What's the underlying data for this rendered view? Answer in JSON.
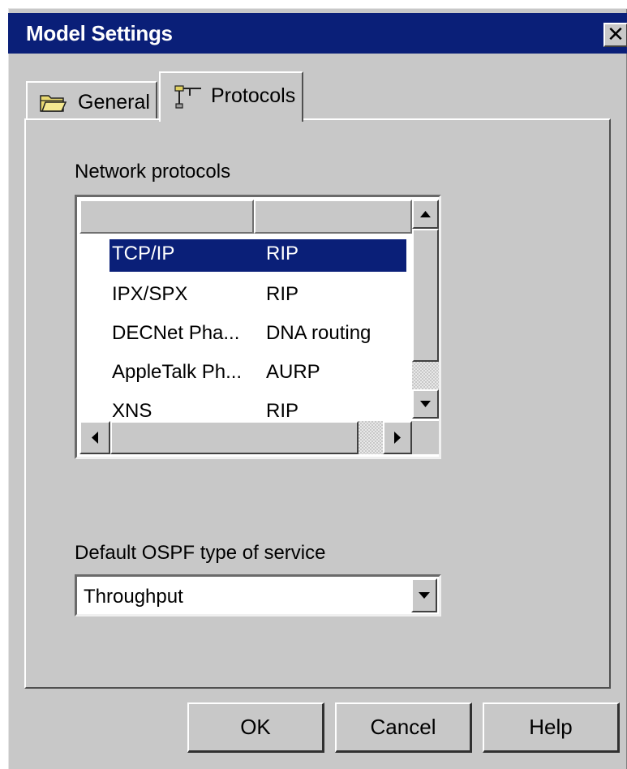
{
  "window": {
    "title": "Model Settings",
    "close_label": "✕"
  },
  "tabs": [
    {
      "label": "General",
      "icon": "folder-icon",
      "active": false
    },
    {
      "label": "Protocols",
      "icon": "network-connector-icon",
      "active": true
    }
  ],
  "network_protocols": {
    "label": "Network protocols",
    "columns": [
      "",
      ""
    ],
    "rows": [
      {
        "protocol": "TCP/IP",
        "routing": "RIP",
        "selected": true
      },
      {
        "protocol": "IPX/SPX",
        "routing": "RIP",
        "selected": false
      },
      {
        "protocol": "DECNet Pha...",
        "routing": "DNA routing",
        "selected": false
      },
      {
        "protocol": "AppleTalk Ph...",
        "routing": "AURP",
        "selected": false
      },
      {
        "protocol": "XNS",
        "routing": "RIP",
        "selected": false
      }
    ]
  },
  "ospf": {
    "label": "Default OSPF type of service",
    "value": "Throughput"
  },
  "buttons": {
    "ok": "OK",
    "cancel": "Cancel",
    "help": "Help"
  },
  "colors": {
    "titlebar": "#0a1f78",
    "face": "#c8c8c8",
    "selection": "#0a1f78"
  }
}
